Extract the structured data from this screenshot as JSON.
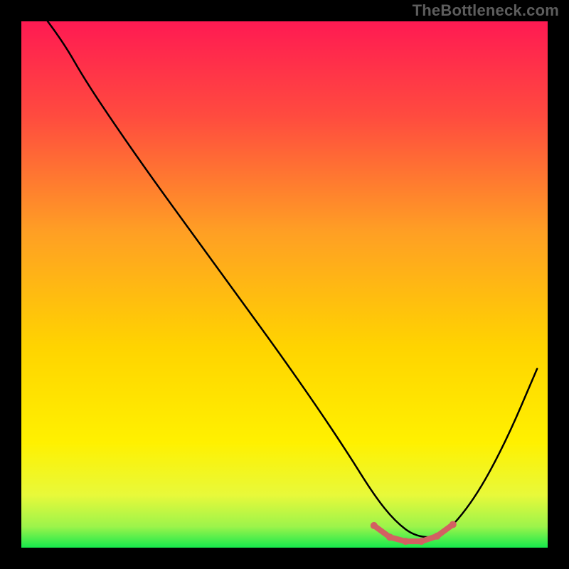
{
  "attribution": "TheBottleneck.com",
  "colors": {
    "page_bg": "#000000",
    "grad_top": "#ff1a52",
    "grad_mid": "#ffe400",
    "grad_bottom": "#16e94c",
    "curve": "#000000",
    "marker": "#d36062"
  },
  "chart_data": {
    "type": "line",
    "title": "",
    "xlabel": "",
    "ylabel": "",
    "xlim": [
      0,
      100
    ],
    "ylim": [
      0,
      100
    ],
    "series": [
      {
        "name": "bottleneck-curve",
        "x": [
          5,
          8,
          12,
          18,
          25,
          33,
          41,
          49,
          56,
          62,
          67,
          71,
          75,
          80,
          86,
          92,
          98
        ],
        "values": [
          100,
          96,
          89,
          80,
          70,
          59,
          48,
          37,
          27,
          18,
          10,
          5,
          2,
          2,
          9,
          20,
          34
        ]
      }
    ],
    "markers": {
      "name": "optimal-band",
      "x": [
        67,
        70,
        73,
        76,
        79,
        82
      ],
      "values": [
        4.2,
        2.0,
        1.2,
        1.2,
        2.2,
        4.4
      ]
    },
    "legend": false,
    "grid": false
  }
}
